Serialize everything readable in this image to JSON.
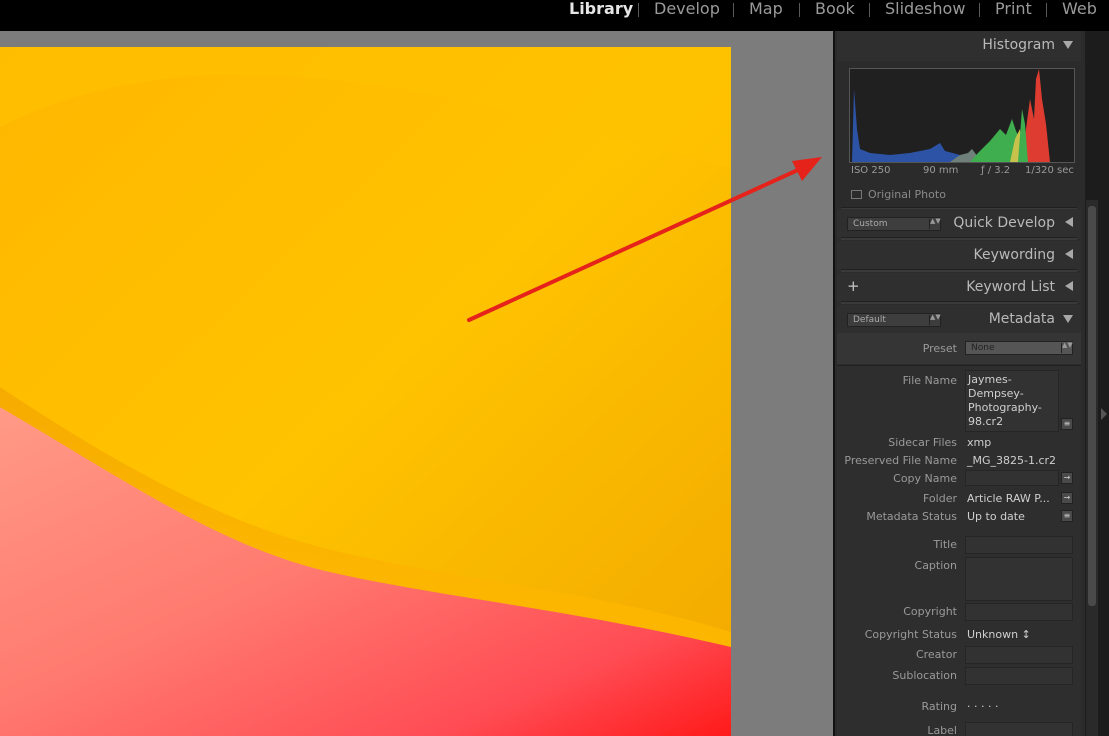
{
  "modules": [
    "Library",
    "Develop",
    "Map",
    "Book",
    "Slideshow",
    "Print",
    "Web"
  ],
  "active_module": "Library",
  "panels": {
    "histogram": {
      "title": "Histogram",
      "iso": "ISO 250",
      "focal": "90 mm",
      "aperture": "ƒ / 3.2",
      "shutter": "1/320 sec",
      "original_photo": "Original Photo"
    },
    "quick_develop": {
      "title": "Quick Develop",
      "preset": "Custom"
    },
    "keywording": {
      "title": "Keywording"
    },
    "keyword_list": {
      "title": "Keyword List",
      "add": "+"
    },
    "metadata": {
      "title": "Metadata",
      "preset_select": "Default",
      "preset_label": "Preset",
      "preset_value": "None",
      "fields": {
        "file_name_label": "File Name",
        "file_name_value": [
          "Jaymes-",
          "Dempsey-",
          "Photography-",
          "98.cr2"
        ],
        "sidecar_label": "Sidecar Files",
        "sidecar_value": "xmp",
        "preserved_label": "Preserved File Name",
        "preserved_value": "_MG_3825-1.cr2",
        "copy_label": "Copy Name",
        "copy_value": "",
        "folder_label": "Folder",
        "folder_value": "Article RAW P...",
        "meta_status_label": "Metadata Status",
        "meta_status_value": "Up to date",
        "title_label": "Title",
        "caption_label": "Caption",
        "copyright_label": "Copyright",
        "copyright_status_label": "Copyright Status",
        "copyright_status_value": "Unknown ↕",
        "creator_label": "Creator",
        "sublocation_label": "Sublocation",
        "rating_label": "Rating",
        "rating_value": "·  ·  ·  ·  ·",
        "label_label": "Label"
      }
    }
  },
  "colors": {
    "arrow": "#e5231b",
    "panel_bg": "#2b2b2b",
    "topbar_bg": "#000000"
  }
}
